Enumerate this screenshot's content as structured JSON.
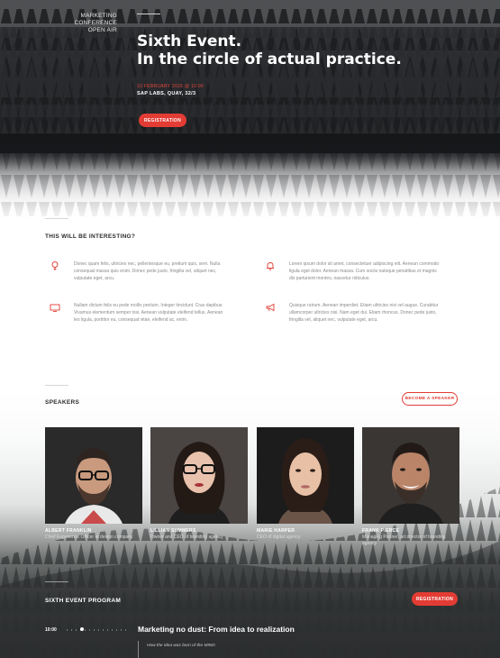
{
  "hero": {
    "brand_line1": "Marketing",
    "brand_line2": "Conference",
    "brand_line3": "Open Air",
    "title_line1": "Sixth Event.",
    "title_line2": "In the circle of actual practice.",
    "date": "10 February 2016 @ 10:00",
    "venue": "SAP LABS, QUAY, 32/3",
    "register_label": "Registration"
  },
  "features": {
    "title": "This will be interesting?",
    "items": [
      {
        "icon": "lightbulb-icon",
        "text": "Donec quam felis, ultricies nec, pellentesque eu, pretium quis, sem. Nulla consequat massa quis enim. Donec pede justo, fringilla vel, aliquet nec, vulputate eget, arcu."
      },
      {
        "icon": "bell-icon",
        "text": "Lorem ipsum dolor sit amet, consectetuer adipiscing elit. Aenean commodo ligula eget dolor. Aenean massa. Cum sociis natoque penatibus et magnis dis parturient montes, nascetur ridiculus."
      },
      {
        "icon": "screen-icon",
        "text": "Nullam dictum felis eu pede mollis pretium. Integer tincidunt. Cras dapibus. Vivamus elementum semper nisi. Aenean vulputate eleifend tellus. Aenean leo ligula, porttitor eu, consequat vitae, eleifend ac, enim."
      },
      {
        "icon": "megaphone-icon",
        "text": "Quisque rutrum. Aenean imperdiet. Etiam ultricies nisi vel augue. Curabitur ullamcorper ultricies nisi. Nam eget dui. Etiam rhoncus. Donec pede justo, fringilla vel, aliquet nec, vulputate eget, arcu."
      }
    ]
  },
  "speakers": {
    "title": "Speakers",
    "become_label": "Become a speaker",
    "items": [
      {
        "name": "Albert Franklin",
        "role": "Chief Experience Officer at design company"
      },
      {
        "name": "Lillian Summers",
        "role": "Owner and CEO of branding agency"
      },
      {
        "name": "Marie Harper",
        "role": "CEO of digital agency"
      },
      {
        "name": "Frank Pierce",
        "role": "Managing Partner, art director of branding agency"
      }
    ]
  },
  "program": {
    "title": "Sixth event program",
    "register_label": "Registration",
    "time": "10:00",
    "session_title": "Marketing no dust: From idea to realization",
    "session_sub": "How the idea was born of the MIND"
  },
  "colors": {
    "accent": "#e23c34"
  }
}
